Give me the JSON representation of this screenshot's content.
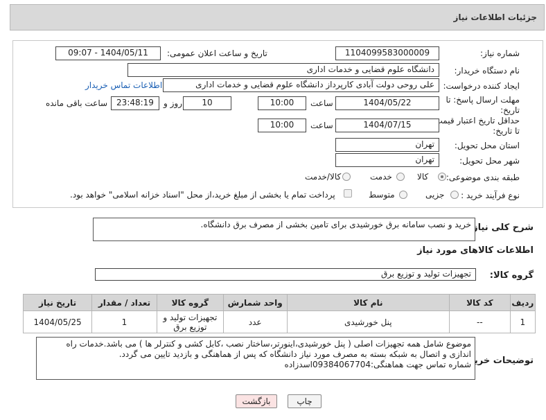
{
  "header": {
    "title": "جزئیات اطلاعات نیاز"
  },
  "form": {
    "need_number_label": "شماره نیاز:",
    "need_number": "1104099583000009",
    "announce_label": "تاریخ و ساعت اعلان عمومی:",
    "announce_value": "1404/05/11 - 09:07",
    "buyer_org_label": "نام دستگاه خریدار:",
    "buyer_org": "دانشگاه علوم قضایی و خدمات اداری",
    "requester_label": "ایجاد کننده درخواست:",
    "requester": "علی روحی دولت آبادی کارپرداز دانشگاه علوم قضایی و خدمات اداری",
    "buyer_contact_link": "اطلاعات تماس خریدار",
    "reply_deadline_label": "مهلت ارسال پاسخ: تا تاریخ:",
    "reply_date": "1404/05/22",
    "time_label": "ساعت",
    "reply_time": "10:00",
    "days_value": "10",
    "days_label": "روز و",
    "remaining_time": "23:48:19",
    "remaining_label": "ساعت باقی مانده",
    "price_validity_label": "حداقل تاریخ اعتبار قیمت: تا تاریخ:",
    "price_date": "1404/07/15",
    "price_time": "10:00",
    "province_label": "استان محل تحویل:",
    "province": "تهران",
    "city_label": "شهر محل تحویل:",
    "city": "تهران",
    "category_label": "طبقه بندی موضوعی:",
    "category_options": [
      "کالا",
      "خدمت",
      "کالا/خدمت"
    ],
    "process_label": "نوع فرآیند خرید :",
    "process_options": [
      "جزیی",
      "متوسط"
    ],
    "payment_note": "پرداخت تمام یا بخشی از مبلغ خرید،از محل \"اسناد خزانه اسلامی\" خواهد بود."
  },
  "summary": {
    "label": "شرح کلی نیاز:",
    "text": "خرید و نصب سامانه برق خورشیدی برای تامین بخشی از مصرف برق دانشگاه."
  },
  "goods": {
    "section_title": "اطلاعات کالاهای مورد نیاز",
    "group_label": "گروه کالا:",
    "group_value": "تجهیزات تولید و توزیع برق",
    "columns": [
      "ردیف",
      "کد کالا",
      "نام کالا",
      "واحد شمارش",
      "گروه کالا",
      "تعداد / مقدار",
      "تاریخ نیاز"
    ],
    "rows": [
      {
        "row": "1",
        "code": "--",
        "name": "پنل خورشیدی",
        "unit": "عدد",
        "group": "تجهیزات تولید و توزیع برق",
        "qty": "1",
        "date": "1404/05/25"
      }
    ]
  },
  "buyer_notes": {
    "label": "توضیحات خریدار:",
    "lines": [
      "موضوع شامل همه تجهیزات اصلی ( پنل خورشیدی،اینورتر،ساختار نصب ،کابل کشی و کنترلر ها ) می باشد.خدمات راه",
      "اندازی و اتصال به شبکه بسته به مصرف مورد نیاز دانشگاه که پس از هماهنگی و بازدید تایین می گردد.",
      "شماره تماس جهت هماهنگی:09384067704اسدزاده"
    ]
  },
  "buttons": {
    "print": "چاپ",
    "back": "بازگشت"
  },
  "colors": {
    "header_bg": "#d9d9d9",
    "table_head": "#d6d6d6",
    "link": "#1a5fb4",
    "back_btn": "#fbe3e3",
    "print_btn": "#f3f3f3"
  }
}
